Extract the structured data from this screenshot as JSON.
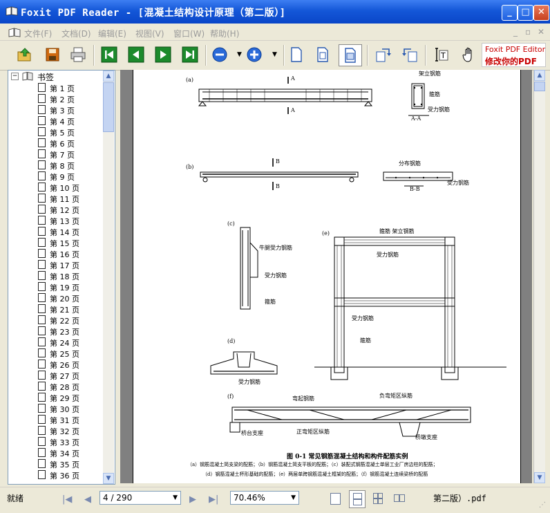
{
  "window": {
    "title": "Foxit PDF Reader - [混凝土结构设计原理（第二版）]",
    "min_label": "_",
    "max_label": "□",
    "close_label": "✕"
  },
  "menu": {
    "items": [
      "文件(F)",
      "文档(D)",
      "编辑(E)",
      "视图(V)",
      "窗口(W)",
      "帮助(H)"
    ]
  },
  "toolbar": {
    "promo_line1": "Foxit PDF Editor",
    "promo_line2": "修改你的PDF"
  },
  "bookmarks": {
    "root_label": "书签",
    "pages": [
      "第 1 页",
      "第 2 页",
      "第 3 页",
      "第 4 页",
      "第 5 页",
      "第 6 页",
      "第 7 页",
      "第 8 页",
      "第 9 页",
      "第 10 页",
      "第 11 页",
      "第 12 页",
      "第 13 页",
      "第 14 页",
      "第 15 页",
      "第 16 页",
      "第 17 页",
      "第 18 页",
      "第 19 页",
      "第 20 页",
      "第 21 页",
      "第 22 页",
      "第 23 页",
      "第 24 页",
      "第 25 页",
      "第 26 页",
      "第 27 页",
      "第 28 页",
      "第 29 页",
      "第 30 页",
      "第 31 页",
      "第 32 页",
      "第 33 页",
      "第 34 页",
      "第 35 页",
      "第 36 页"
    ]
  },
  "figure": {
    "label_a": "(a)",
    "label_b": "(b)",
    "label_c": "(c)",
    "label_d": "(d)",
    "label_e": "(e)",
    "label_f": "(f)",
    "sec_a": "A",
    "sec_b": "B",
    "sec_aa": "A-A",
    "sec_bb": "B-B",
    "a_top": "架立钢筋",
    "a_mid": "箍筋",
    "a_bot": "受力钢筋",
    "b_top": "分布钢筋",
    "b_bot": "受力钢筋",
    "c_1": "牛腿受力钢筋",
    "c_2": "受力钢筋",
    "c_3": "箍筋",
    "d_1": "受力钢筋",
    "e_top": "箍筋 架立钢筋",
    "e_1": "受力钢筋",
    "e_2": "受力钢筋",
    "e_3": "箍筋",
    "f_1": "弯起钢筋",
    "f_2": "负弯矩区纵筋",
    "f_3": "桥台支座",
    "f_4": "正弯矩区纵筋",
    "f_5": "桥墩支座",
    "caption": "图 0-1   常见钢筋混凝土结构和构件配筋实例",
    "caption_line1": "（a）钢筋混凝土简支梁的配筋；（b）钢筋混凝土简支平板的配筋；（c）装配式钢筋混凝土单层工业厂房边柱的配筋；",
    "caption_line2": "（d）钢筋混凝土杯形基础的配筋；（e）两层单跨钢筋混凝土框架的配筋；（f）钢筋混凝土连续梁桥的配筋"
  },
  "status": {
    "ready": "就绪",
    "page_value": "4 / 290",
    "zoom_value": "70.46%",
    "doc_name": "第二版）.pdf"
  }
}
